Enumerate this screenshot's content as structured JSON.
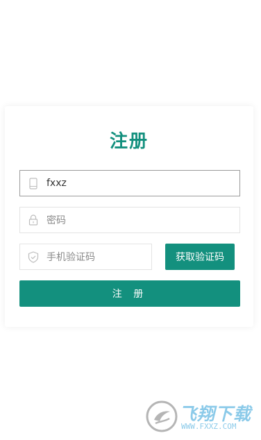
{
  "register": {
    "title": "注册",
    "phone": {
      "value": "fxxz",
      "icon": "phone-icon"
    },
    "password": {
      "placeholder": "密码",
      "icon": "lock-icon"
    },
    "sms_code": {
      "placeholder": "手机验证码",
      "icon": "shield-icon"
    },
    "get_code_label": "获取验证码",
    "submit_label": "注 册"
  },
  "watermark": {
    "brand": "飞翔下载",
    "url": "WWW.FXXZ.COM"
  },
  "colors": {
    "accent": "#13907e",
    "border": "#e3e3e3",
    "active_border": "#9a9a9a"
  }
}
